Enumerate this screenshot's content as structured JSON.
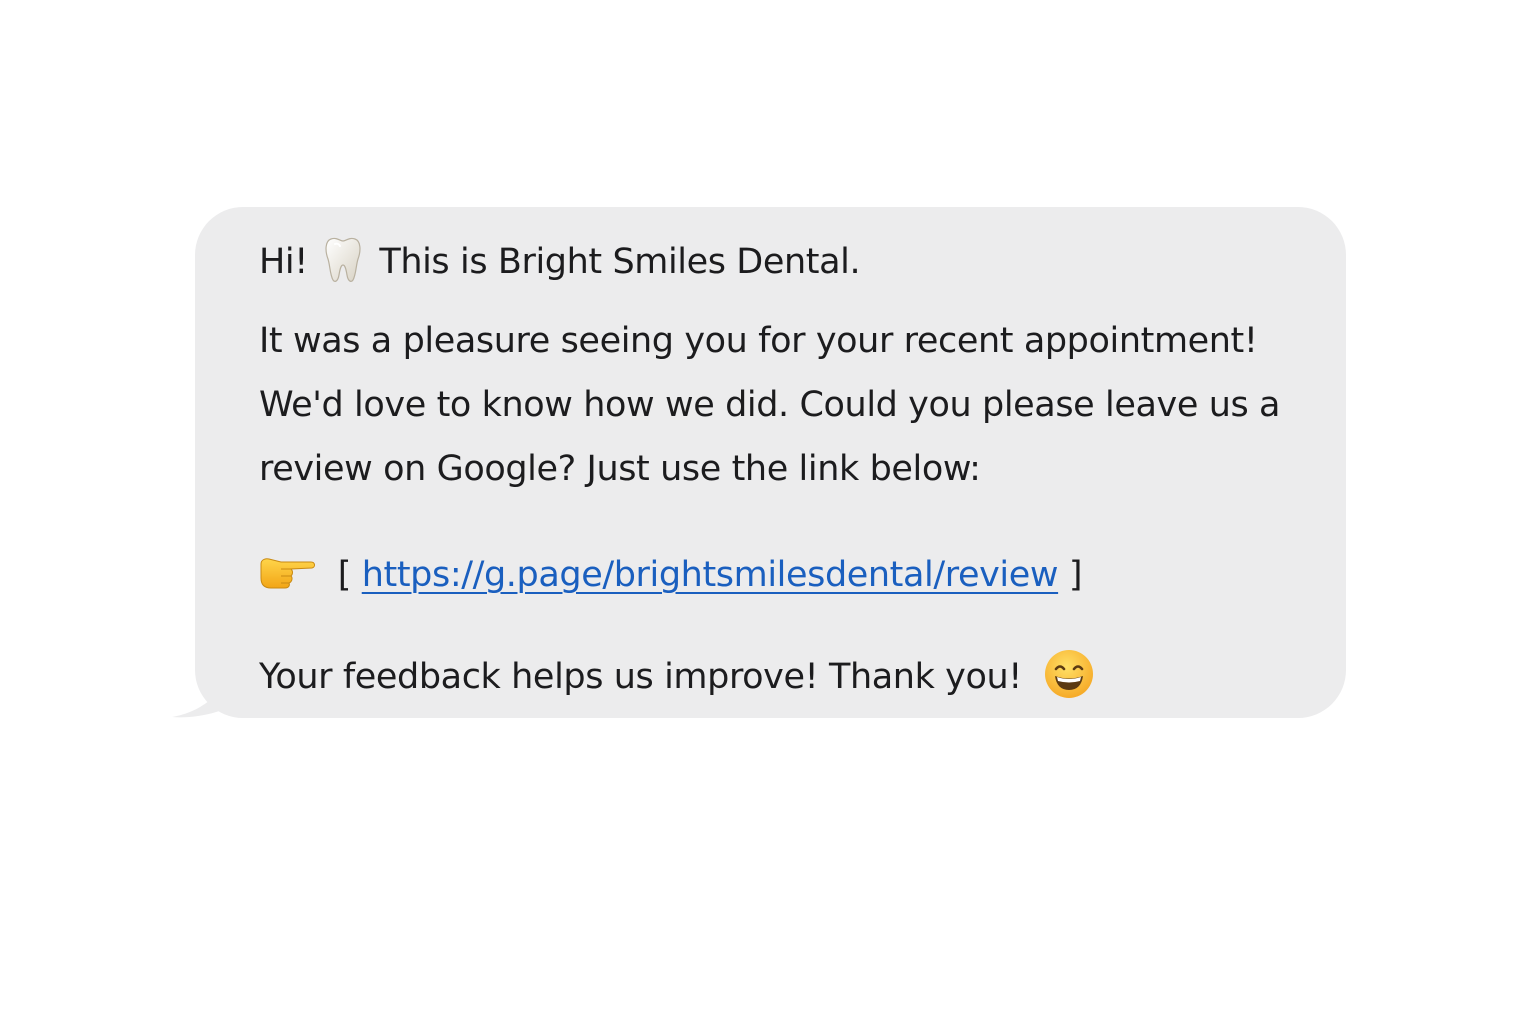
{
  "message": {
    "greeting_pre": "Hi!",
    "greeting_post": "This is Bright Smiles Dental.",
    "body_line1": "It was a pleasure seeing you for your recent appointment!",
    "body_line2": "We'd love to know how we did. Could you please leave us a",
    "body_line3": "review on Google? Just use the link below:",
    "link_open_bracket": "[",
    "link_text": "https://g.page/brightsmilesdental/review",
    "link_close_bracket": "]",
    "closing": "Your feedback helps us improve! Thank you!"
  },
  "icons": {
    "greeting": "tooth-icon",
    "link": "pointing-right-hand-icon",
    "closing": "grinning-face-icon"
  },
  "colors": {
    "bubble": "#ececed",
    "text": "#1c1c1e",
    "link": "#1a5fbf",
    "background": "#ffffff"
  }
}
